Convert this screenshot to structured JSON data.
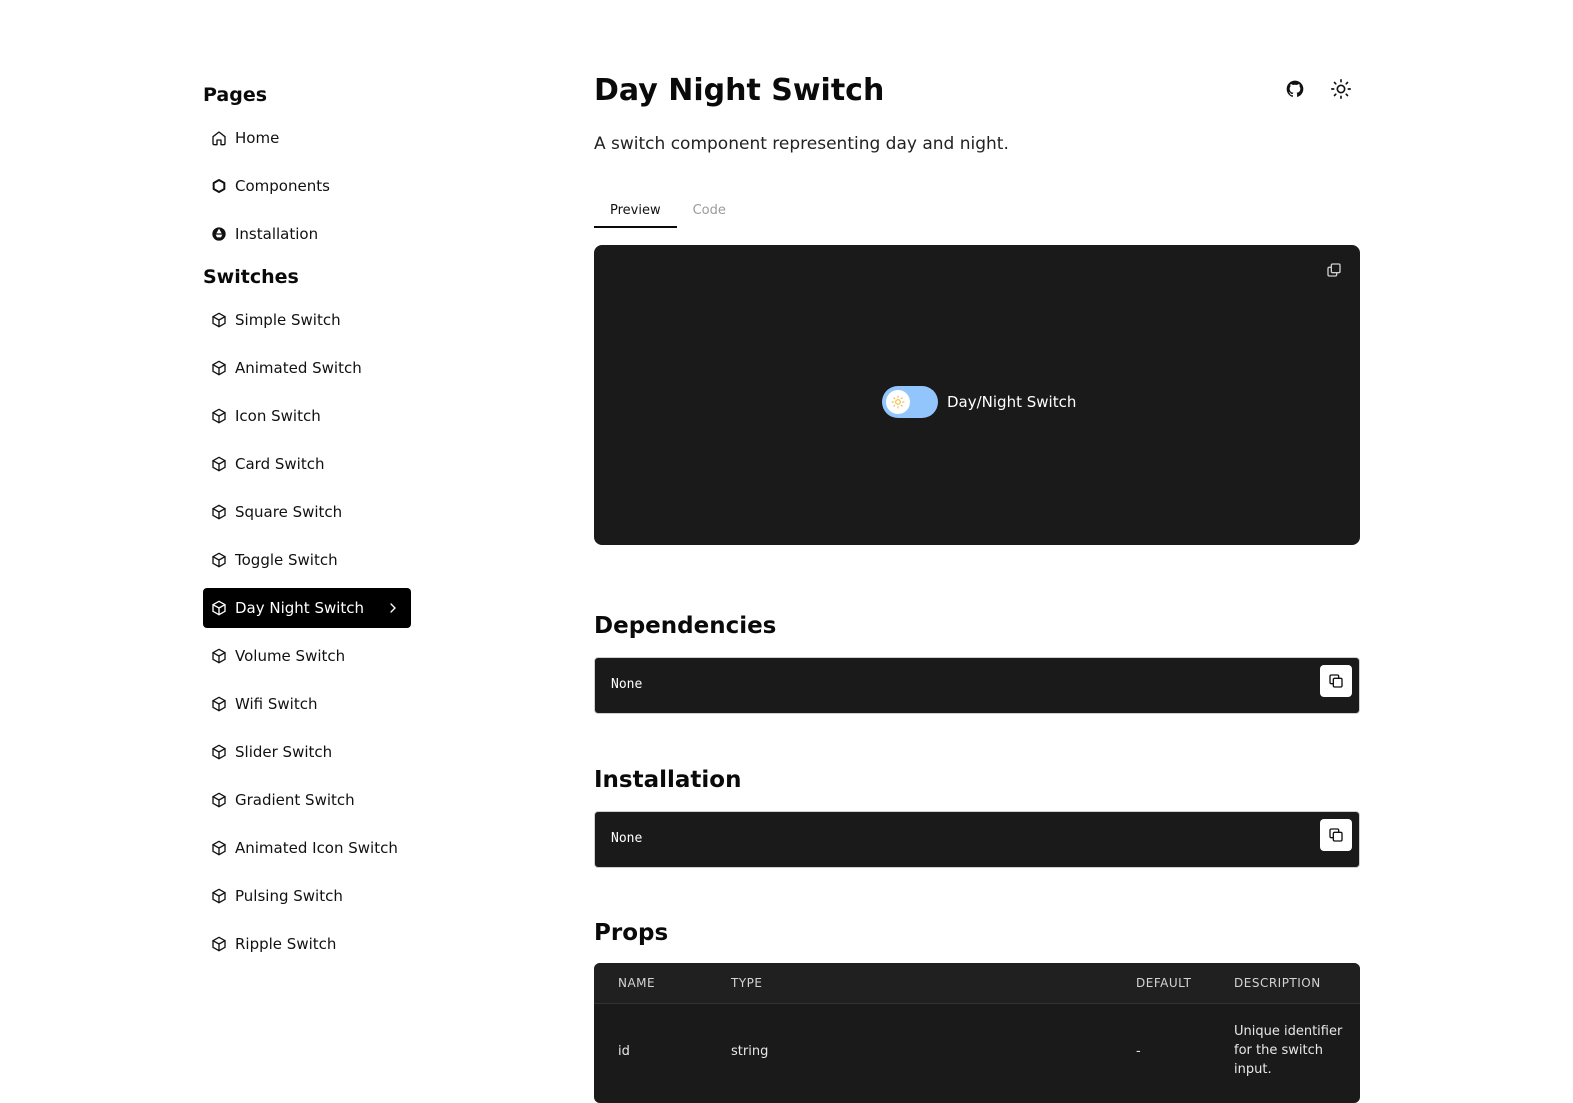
{
  "sidebar": {
    "pages_title": "Pages",
    "pages": [
      {
        "label": "Home",
        "icon": "home-icon"
      },
      {
        "label": "Components",
        "icon": "hexagon-icon"
      },
      {
        "label": "Installation",
        "icon": "drive-icon"
      }
    ],
    "switches_title": "Switches",
    "switches": [
      {
        "label": "Simple Switch",
        "icon": "box-icon"
      },
      {
        "label": "Animated Switch",
        "icon": "box-icon"
      },
      {
        "label": "Icon Switch",
        "icon": "box-icon"
      },
      {
        "label": "Card Switch",
        "icon": "box-icon"
      },
      {
        "label": "Square Switch",
        "icon": "box-icon"
      },
      {
        "label": "Toggle Switch",
        "icon": "box-icon"
      },
      {
        "label": "Day Night Switch",
        "icon": "box-icon",
        "active": true
      },
      {
        "label": "Volume Switch",
        "icon": "box-icon"
      },
      {
        "label": "Wifi Switch",
        "icon": "box-icon"
      },
      {
        "label": "Slider Switch",
        "icon": "box-icon"
      },
      {
        "label": "Gradient Switch",
        "icon": "box-icon"
      },
      {
        "label": "Animated Icon Switch",
        "icon": "box-icon"
      },
      {
        "label": "Pulsing Switch",
        "icon": "box-icon"
      },
      {
        "label": "Ripple Switch",
        "icon": "box-icon"
      }
    ]
  },
  "header": {
    "title": "Day Night Switch",
    "subtitle": "A switch component representing day and night.",
    "icons": [
      "github-icon",
      "sun-icon"
    ]
  },
  "tabs": [
    {
      "label": "Preview",
      "active": true
    },
    {
      "label": "Code",
      "active": false
    }
  ],
  "preview": {
    "switch_label": "Day/Night Switch",
    "track_color": "#93c5fd",
    "bg_color": "#1a1a1a"
  },
  "dependencies": {
    "title": "Dependencies",
    "code": "None"
  },
  "installation": {
    "title": "Installation",
    "code": "None"
  },
  "props": {
    "title": "Props",
    "headers": [
      "NAME",
      "TYPE",
      "DEFAULT",
      "DESCRIPTION"
    ],
    "rows": [
      {
        "name": "id",
        "type": "string",
        "default": "-",
        "description": "Unique identifier for the switch input."
      }
    ]
  }
}
